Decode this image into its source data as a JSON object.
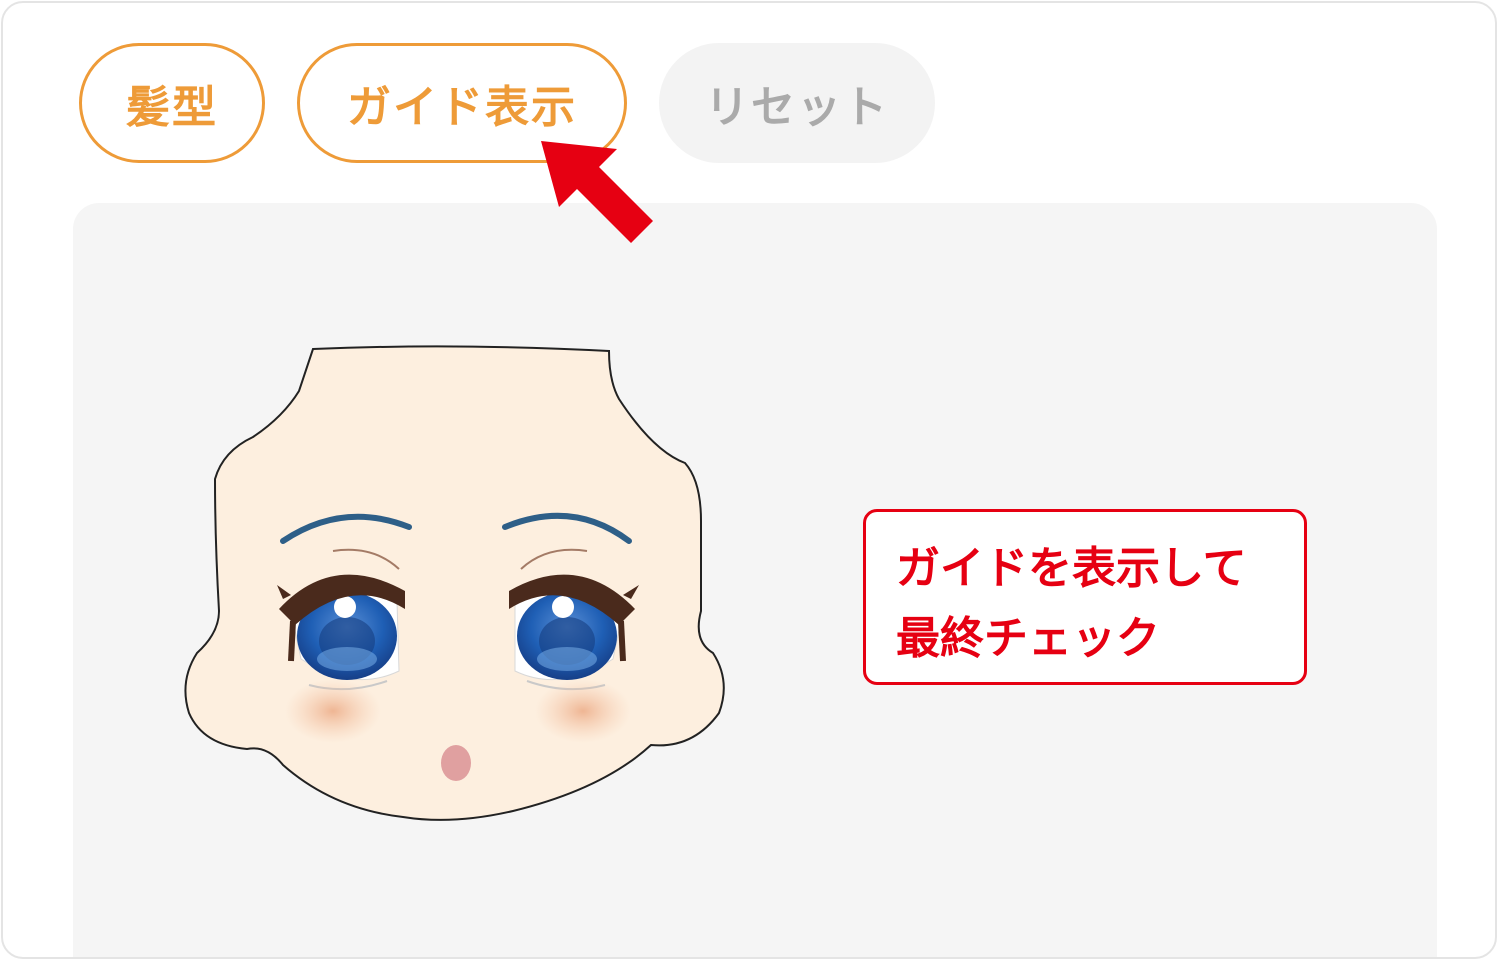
{
  "toolbar": {
    "hair_label": "髪型",
    "guide_label": "ガイド表示",
    "reset_label": "リセット"
  },
  "annotation": {
    "line1": "ガイドを表示して",
    "line2": "最終チェック"
  },
  "colors": {
    "accent_orange": "#ee9b38",
    "annotation_red": "#e60012",
    "canvas_bg": "#f5f5f5",
    "skin": "#fdefdf",
    "eye_blue": "#1f5fb5",
    "brow_blue": "#2e5f88"
  },
  "icons": {
    "pointer": "red-arrow-icon"
  }
}
